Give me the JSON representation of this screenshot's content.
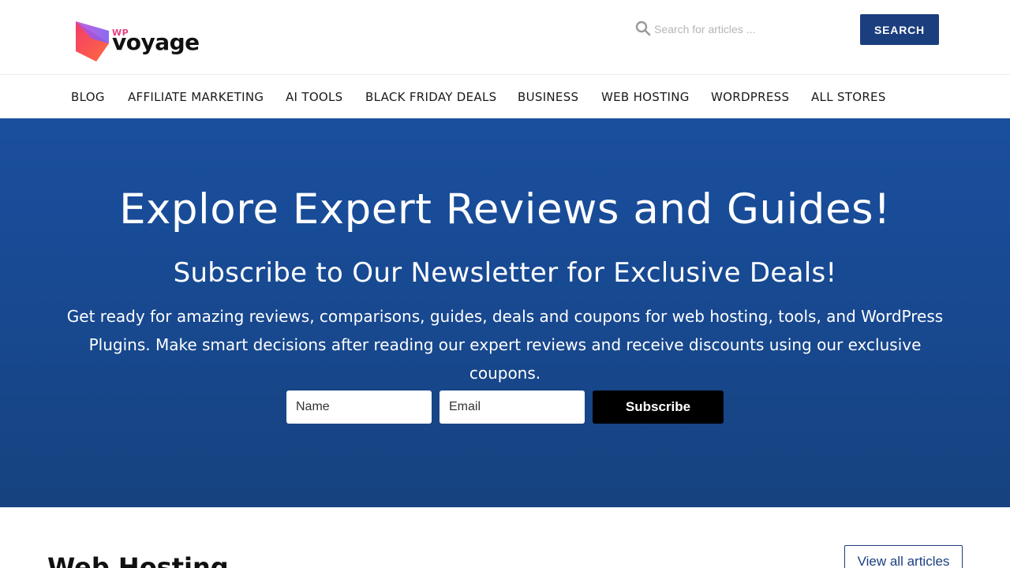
{
  "brand": {
    "prefix": "WP",
    "name": "voyage",
    "colors": {
      "mark_pink": "#f23c6b",
      "mark_purple": "#9b4fe0",
      "prefix": "#e8407e"
    }
  },
  "search": {
    "placeholder": "Search for articles ...",
    "button_label": "SEARCH",
    "icon": "search-icon"
  },
  "nav": {
    "items": [
      {
        "label": "BLOG"
      },
      {
        "label": "AFFILIATE MARKETING"
      },
      {
        "label": "AI TOOLS"
      },
      {
        "label": "BLACK FRIDAY DEALS"
      },
      {
        "label": "BUSINESS"
      },
      {
        "label": "WEB HOSTING"
      },
      {
        "label": "WORDPRESS"
      },
      {
        "label": "ALL STORES"
      }
    ]
  },
  "hero": {
    "title": "Explore Expert Reviews and Guides!",
    "subtitle": "Subscribe to Our Newsletter for Exclusive Deals!",
    "description_line1": "Get ready for amazing reviews, comparisons, guides, deals and coupons for web hosting, tools, and WordPress",
    "description_line2": "Plugins. Make smart decisions after reading our expert reviews and receive discounts using our exclusive coupons.",
    "name_placeholder": "Name",
    "email_placeholder": "Email",
    "subscribe_label": "Subscribe",
    "colors": {
      "background": "#184a93",
      "button": "#000000"
    }
  },
  "section": {
    "title": "Web Hosting",
    "view_all_label": "View all articles"
  },
  "theme": {
    "accent": "#1b3f7e"
  }
}
